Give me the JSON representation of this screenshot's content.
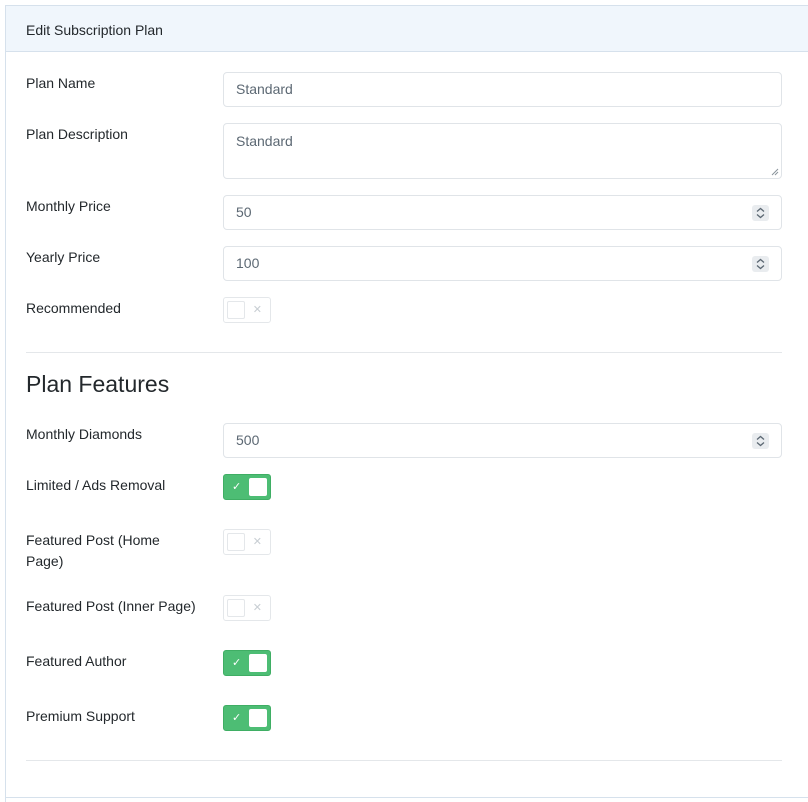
{
  "card": {
    "title": "Edit Subscription Plan"
  },
  "form": {
    "plan_name": {
      "label": "Plan Name",
      "value": "Standard"
    },
    "plan_description": {
      "label": "Plan Description",
      "value": "Standard"
    },
    "monthly_price": {
      "label": "Monthly Price",
      "value": "50"
    },
    "yearly_price": {
      "label": "Yearly Price",
      "value": "100"
    },
    "recommended": {
      "label": "Recommended",
      "checked": false,
      "glyph": "✕"
    }
  },
  "features": {
    "heading": "Plan Features",
    "monthly_diamonds": {
      "label": "Monthly Diamonds",
      "value": "500"
    },
    "ads_removal": {
      "label": "Limited / Ads Removal",
      "checked": true,
      "glyph": "✓"
    },
    "featured_post_home": {
      "label": "Featured Post (Home Page)",
      "checked": false,
      "glyph": "✕"
    },
    "featured_post_inner": {
      "label": "Featured Post (Inner Page)",
      "checked": false,
      "glyph": "✕"
    },
    "featured_author": {
      "label": "Featured Author",
      "checked": true,
      "glyph": "✓"
    },
    "premium_support": {
      "label": "Premium Support",
      "checked": true,
      "glyph": "✓"
    }
  },
  "colors": {
    "header_bg": "#f0f6fc",
    "toggle_on": "#4dbd74",
    "border": "#e0e4e8"
  },
  "icons": {
    "spinner": "number-spinner-icon",
    "resize": "resize-grip-icon"
  }
}
